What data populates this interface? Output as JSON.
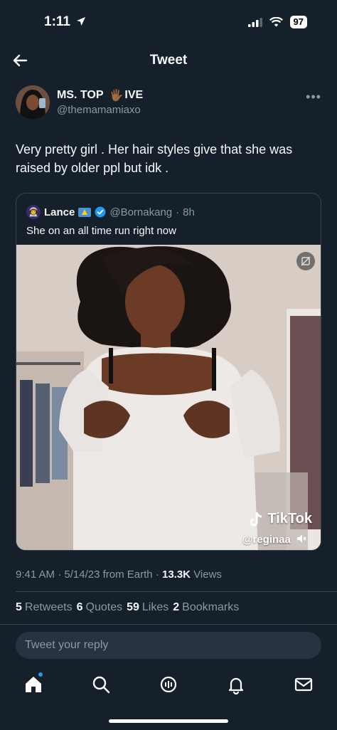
{
  "status": {
    "time": "1:11",
    "battery": "97"
  },
  "header": {
    "title": "Tweet"
  },
  "author": {
    "name": "MS. TOP",
    "name_suffix": "IVE",
    "hand_emoji": "🖐🏾",
    "handle": "@themamamiaxo"
  },
  "tweet": {
    "text": "Very pretty girl . Her hair styles give that she was raised by older ppl but idk ."
  },
  "quote": {
    "name": "Lance",
    "handle": "@Bornakang",
    "dot": "·",
    "time": "8h",
    "text": "She on an all time run right now",
    "media": {
      "watermark": "TikTok",
      "watermark_user": "@reginaa"
    }
  },
  "meta": {
    "time": "9:41 AM",
    "date": "5/14/23",
    "source": "from Earth",
    "views_count": "13.3K",
    "views_label": "Views",
    "sep": "·"
  },
  "stats": [
    {
      "count": "5",
      "label": "Retweets"
    },
    {
      "count": "6",
      "label": "Quotes"
    },
    {
      "count": "59",
      "label": "Likes"
    },
    {
      "count": "2",
      "label": "Bookmarks"
    }
  ],
  "reply": {
    "placeholder": "Tweet your reply"
  },
  "tabbar": {
    "items": [
      "home-icon",
      "search-icon",
      "spaces-icon",
      "notifications-icon",
      "messages-icon"
    ]
  },
  "colors": {
    "background": "#15202b",
    "accent": "#1d9bf0",
    "muted": "#8b98a5",
    "border": "#38444d"
  }
}
